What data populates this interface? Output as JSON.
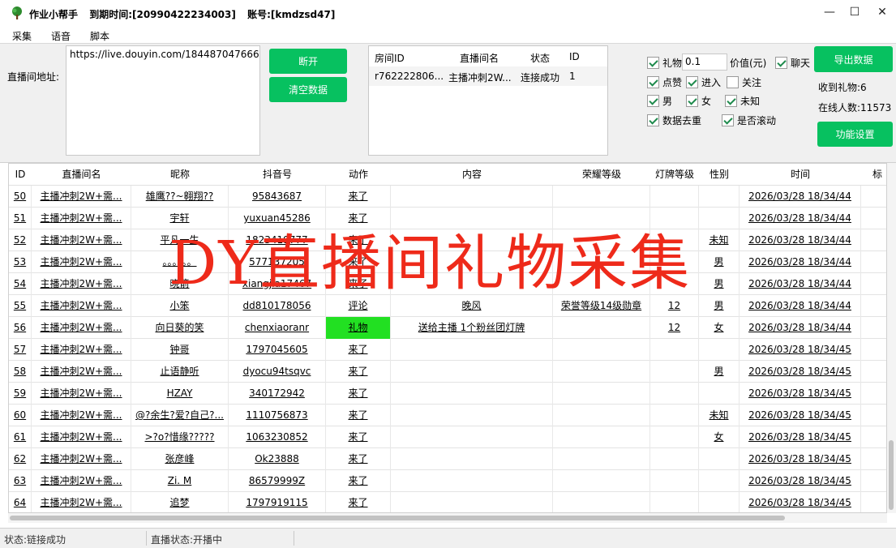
{
  "window": {
    "app_name": "作业小帮手",
    "expiry": "到期时间:[20990422234003]",
    "account": "账号:[kmdzsd47]",
    "min": "—",
    "max": "☐",
    "close": "✕"
  },
  "menu": [
    "采集",
    "语音",
    "脚本"
  ],
  "controls": {
    "url_label": "直播间地址:",
    "url_value": "https://live.douyin.com/184487047666",
    "disconnect": "断开",
    "clear": "清空数据",
    "export": "导出数据",
    "settings": "功能设置"
  },
  "room": {
    "headers": [
      "房间ID",
      "直播间名",
      "状态",
      "ID"
    ],
    "row": [
      "r762222806...",
      "主播冲刺2W...",
      "连接成功",
      "1"
    ]
  },
  "options": {
    "gift": "礼物",
    "gift_value": "0.1",
    "value_unit": "价值(元)",
    "chat": "聊天",
    "like": "点赞",
    "enter": "进入",
    "follow": "关注",
    "male": "男",
    "female": "女",
    "unknown": "未知",
    "dedupe": "数据去重",
    "scroll": "是否滚动"
  },
  "stats": {
    "gifts_received": "收到礼物:6",
    "online": "在线人数:11573"
  },
  "grid": {
    "headers": [
      "ID",
      "直播间名",
      "昵称",
      "抖音号",
      "动作",
      "内容",
      "荣耀等级",
      "灯牌等级",
      "性别",
      "时间",
      "标"
    ],
    "rows": [
      [
        "50",
        "主播冲刺2W+需...",
        "雄鹰??~翱翔??",
        "95843687",
        "来了",
        "",
        "",
        "",
        "",
        "2026/03/28 18/34/44"
      ],
      [
        "51",
        "主播冲刺2W+需...",
        "宇轩",
        "yuxuan45286",
        "来了",
        "",
        "",
        "",
        "",
        "2026/03/28 18/34/44"
      ],
      [
        "52",
        "主播冲刺2W+需...",
        "平凡一生",
        "1823419777",
        "来了",
        "",
        "",
        "",
        "未知",
        "2026/03/28 18/34/44"
      ],
      [
        "53",
        "主播冲刺2W+需...",
        "。。。。。。",
        "577137205",
        "来了",
        "",
        "",
        "",
        "男",
        "2026/03/28 18/34/44"
      ],
      [
        "54",
        "主播冲刺2W+需...",
        "晓箭",
        "xiangjia17467",
        "来了",
        "",
        "",
        "",
        "男",
        "2026/03/28 18/34/44"
      ],
      [
        "55",
        "主播冲刺2W+需...",
        "小笨",
        "dd810178056",
        "评论",
        "晚风",
        "荣誉等级14级勋章",
        "12",
        "男",
        "2026/03/28 18/34/44"
      ],
      [
        "56",
        "主播冲刺2W+需...",
        "向日葵的笑",
        "chenxiaoranr",
        "礼物",
        "送给主播 1个粉丝团灯牌",
        "",
        "12",
        "女",
        "2026/03/28 18/34/44"
      ],
      [
        "57",
        "主播冲刺2W+需...",
        "钟哥",
        "1797045605",
        "来了",
        "",
        "",
        "",
        "",
        "2026/03/28 18/34/45"
      ],
      [
        "58",
        "主播冲刺2W+需...",
        "止语静听",
        "dyocu94tsqvc",
        "来了",
        "",
        "",
        "",
        "男",
        "2026/03/28 18/34/45"
      ],
      [
        "59",
        "主播冲刺2W+需...",
        "HZAY",
        "340172942",
        "来了",
        "",
        "",
        "",
        "",
        "2026/03/28 18/34/45"
      ],
      [
        "60",
        "主播冲刺2W+需...",
        "@?余生?爱?自己?...",
        "1110756873",
        "来了",
        "",
        "",
        "",
        "未知",
        "2026/03/28 18/34/45"
      ],
      [
        "61",
        "主播冲刺2W+需...",
        ">?o?惜缘?????",
        "1063230852",
        "来了",
        "",
        "",
        "",
        "女",
        "2026/03/28 18/34/45"
      ],
      [
        "62",
        "主播冲刺2W+需...",
        "张彦峰",
        "Ok23888",
        "来了",
        "",
        "",
        "",
        "",
        "2026/03/28 18/34/45"
      ],
      [
        "63",
        "主播冲刺2W+需...",
        "Zi. M",
        "86579999Z",
        "来了",
        "",
        "",
        "",
        "",
        "2026/03/28 18/34/45"
      ],
      [
        "64",
        "主播冲刺2W+需...",
        "追梦",
        "1797919115",
        "来了",
        "",
        "",
        "",
        "",
        "2026/03/28 18/34/45"
      ]
    ]
  },
  "status": {
    "link": "状态:链接成功",
    "live": "直播状态:开播中"
  },
  "watermark": "DY直播间礼物采集",
  "colors": {
    "accent": "#07c160",
    "gift_highlight": "#22e022",
    "watermark": "#ee2a1a"
  }
}
